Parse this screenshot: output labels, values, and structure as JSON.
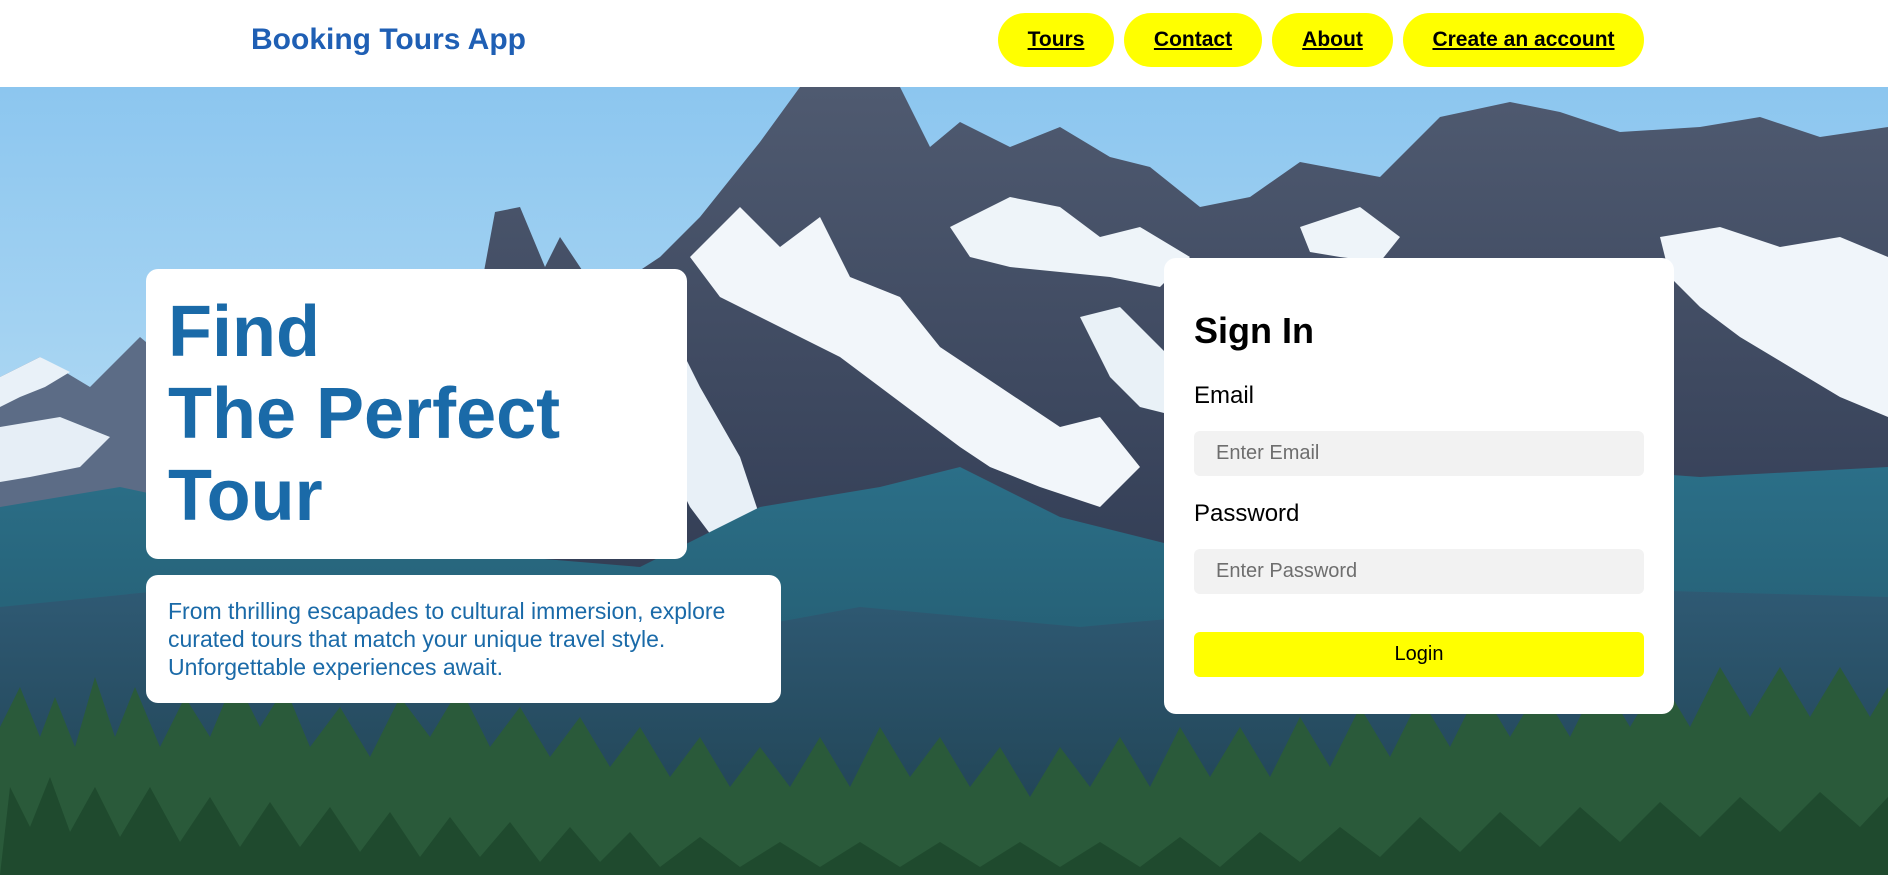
{
  "header": {
    "brand": "Booking Tours App",
    "nav": [
      {
        "label": "Tours"
      },
      {
        "label": "Contact"
      },
      {
        "label": "About"
      },
      {
        "label": "Create an account"
      }
    ]
  },
  "hero": {
    "headline": [
      "Find",
      "The Perfect",
      "Tour"
    ],
    "description": "From thrilling escapades to cultural immersion, explore curated tours that match your unique travel style. Unforgettable experiences await."
  },
  "signin": {
    "title": "Sign In",
    "email_label": "Email",
    "email_placeholder": "Enter Email",
    "email_value": "",
    "password_label": "Password",
    "password_placeholder": "Enter Password",
    "password_value": "",
    "login_label": "Login"
  },
  "colors": {
    "brand": "#1f5fb4",
    "headline": "#1a6aa8",
    "nav_button_bg": "#ffff00",
    "login_button_bg": "#ffff00",
    "input_bg": "#f2f2f2"
  },
  "icons": {
    "background": "mountain-landscape-photo"
  }
}
